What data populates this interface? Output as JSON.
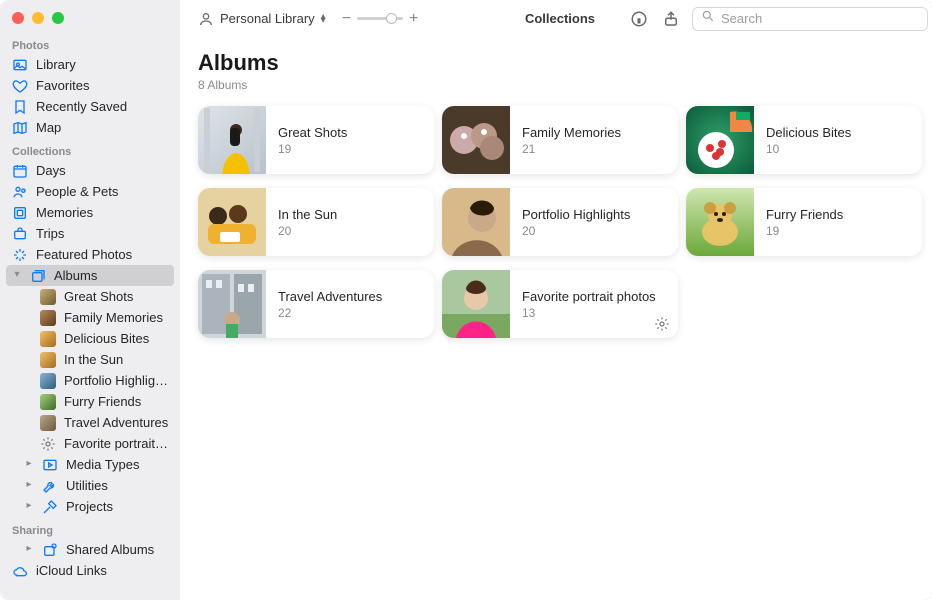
{
  "toolbar": {
    "library_dropdown": "Personal Library",
    "center_title": "Collections",
    "search_placeholder": "Search"
  },
  "sidebar": {
    "sections": {
      "photos": {
        "header": "Photos"
      },
      "collections": {
        "header": "Collections"
      },
      "sharing": {
        "header": "Sharing"
      }
    },
    "photos_items": [
      {
        "label": "Library"
      },
      {
        "label": "Favorites"
      },
      {
        "label": "Recently Saved"
      },
      {
        "label": "Map"
      }
    ],
    "collections_items": [
      {
        "label": "Days"
      },
      {
        "label": "People & Pets"
      },
      {
        "label": "Memories"
      },
      {
        "label": "Trips"
      },
      {
        "label": "Featured Photos"
      },
      {
        "label": "Albums"
      },
      {
        "label": "Media Types"
      },
      {
        "label": "Utilities"
      },
      {
        "label": "Projects"
      }
    ],
    "album_children": [
      {
        "label": "Great Shots"
      },
      {
        "label": "Family Memories"
      },
      {
        "label": "Delicious Bites"
      },
      {
        "label": "In the Sun"
      },
      {
        "label": "Portfolio Highlights"
      },
      {
        "label": "Furry Friends"
      },
      {
        "label": "Travel Adventures"
      },
      {
        "label": "Favorite portrait photos"
      }
    ],
    "sharing_items": [
      {
        "label": "Shared Albums"
      },
      {
        "label": "iCloud Links"
      }
    ]
  },
  "page": {
    "title": "Albums",
    "subcount": "8 Albums"
  },
  "albums": [
    {
      "name": "Great Shots",
      "count": "19",
      "cover": "gs"
    },
    {
      "name": "Family Memories",
      "count": "21",
      "cover": "fm"
    },
    {
      "name": "Delicious Bites",
      "count": "10",
      "cover": "db"
    },
    {
      "name": "In the Sun",
      "count": "20",
      "cover": "is"
    },
    {
      "name": "Portfolio Highlights",
      "count": "20",
      "cover": "ph"
    },
    {
      "name": "Furry Friends",
      "count": "19",
      "cover": "ff"
    },
    {
      "name": "Travel Adventures",
      "count": "22",
      "cover": "ta"
    },
    {
      "name": "Favorite portrait photos",
      "count": "13",
      "cover": "fp",
      "gear": true
    }
  ]
}
